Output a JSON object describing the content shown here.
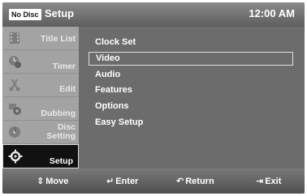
{
  "header": {
    "badge": "No Disc",
    "title": "Setup",
    "time": "12:00 AM"
  },
  "sidebar": {
    "items": [
      {
        "label": "Title List",
        "icon": "film-icon",
        "active": false
      },
      {
        "label": "Timer",
        "icon": "clock-disc-icon",
        "active": false
      },
      {
        "label": "Edit",
        "icon": "scissors-icon",
        "active": false
      },
      {
        "label": "Dubbing",
        "icon": "dubbing-icon",
        "active": false
      },
      {
        "label_line1": "Disc",
        "label_line2": "Setting",
        "icon": "disc-settings-icon",
        "active": false
      },
      {
        "label": "Setup",
        "icon": "gear-icon",
        "active": true
      }
    ]
  },
  "menu": {
    "items": [
      "Clock Set",
      "Video",
      "Audio",
      "Features",
      "Options",
      "Easy Setup"
    ],
    "selected": "Video"
  },
  "footer": {
    "move": "Move",
    "enter": "Enter",
    "return": "Return",
    "exit": "Exit"
  },
  "colors": {
    "panel": "#6c6c6c",
    "sidebar": "#a3a3a3",
    "active": "#111111",
    "text": "#ffffff"
  }
}
